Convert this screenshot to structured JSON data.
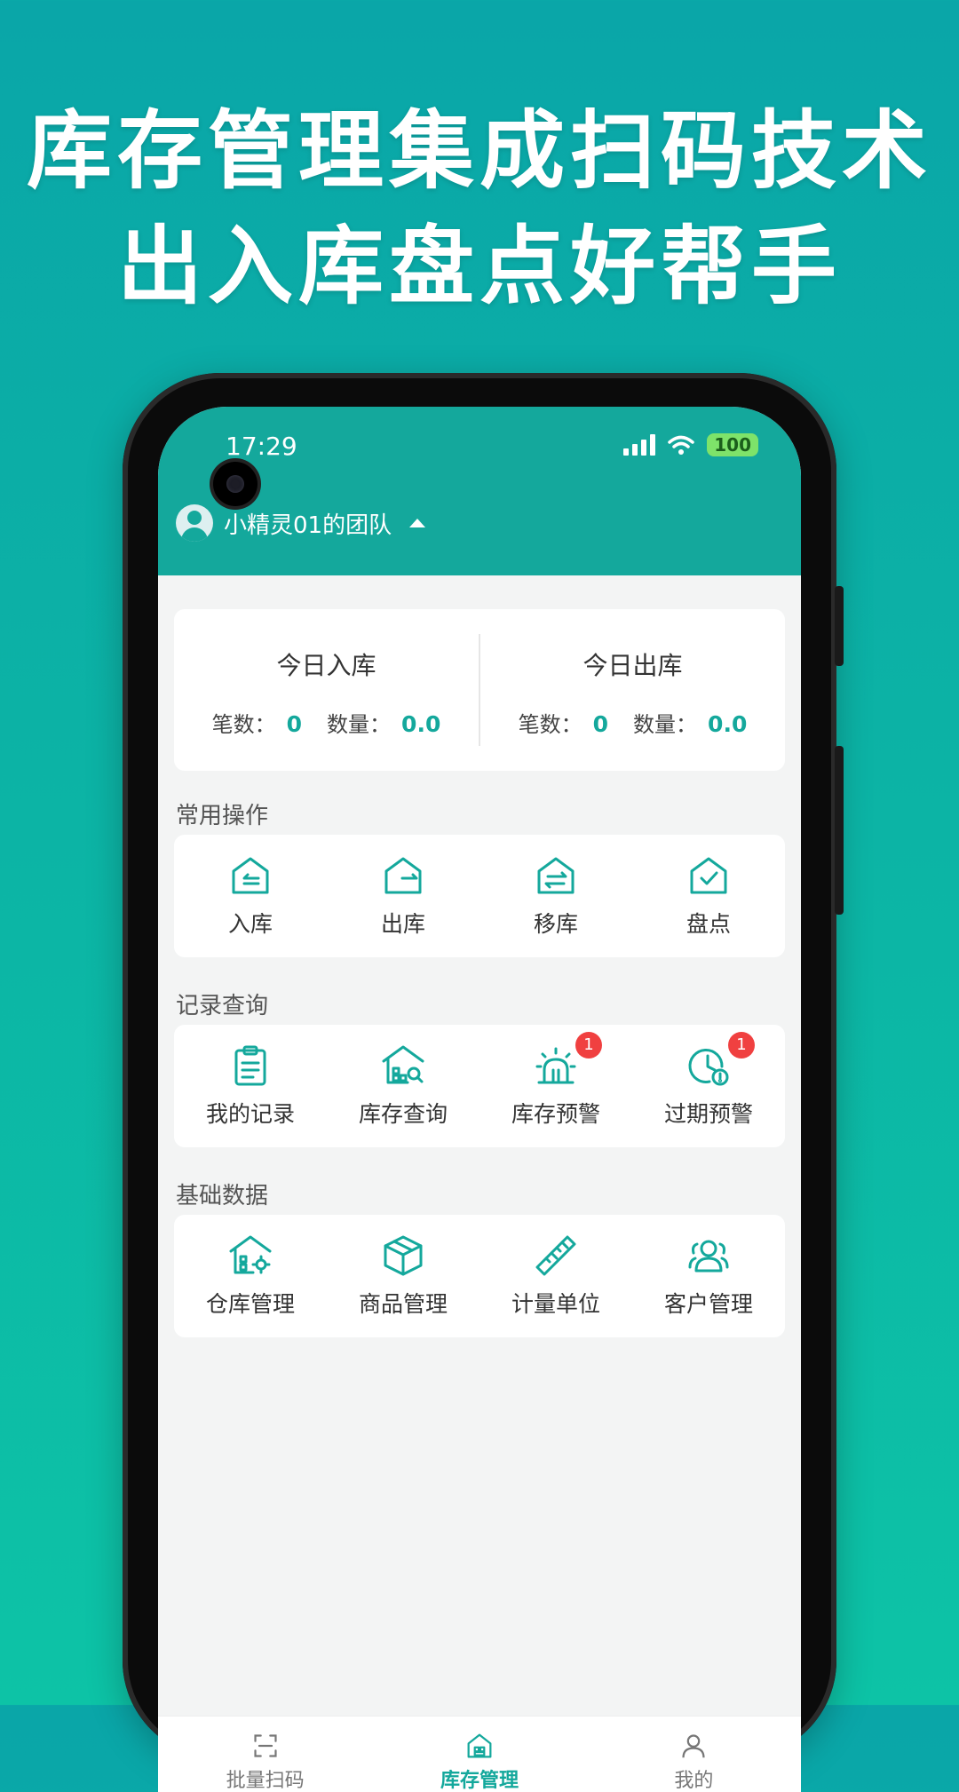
{
  "promo": {
    "line1": "库存管理集成扫码技术",
    "line2": "出入库盘点好帮手"
  },
  "status": {
    "time": "17:29",
    "battery": "100"
  },
  "header": {
    "team_name": "小精灵01的团队"
  },
  "today": {
    "in": {
      "title": "今日入库",
      "count_label": "笔数：",
      "count": "0",
      "qty_label": "数量：",
      "qty": "0.0"
    },
    "out": {
      "title": "今日出库",
      "count_label": "笔数：",
      "count": "0",
      "qty_label": "数量：",
      "qty": "0.0"
    }
  },
  "sections": {
    "common": {
      "title": "常用操作",
      "items": [
        "入库",
        "出库",
        "移库",
        "盘点"
      ]
    },
    "records": {
      "title": "记录查询",
      "items": [
        "我的记录",
        "库存查询",
        "库存预警",
        "过期预警"
      ],
      "badges": [
        "1",
        "1"
      ]
    },
    "basic": {
      "title": "基础数据",
      "items": [
        "仓库管理",
        "商品管理",
        "计量单位",
        "客户管理"
      ]
    }
  },
  "tabs": [
    "批量扫码",
    "库存管理",
    "我的"
  ],
  "colors": {
    "primary": "#14a89c",
    "badge": "#f04040"
  }
}
